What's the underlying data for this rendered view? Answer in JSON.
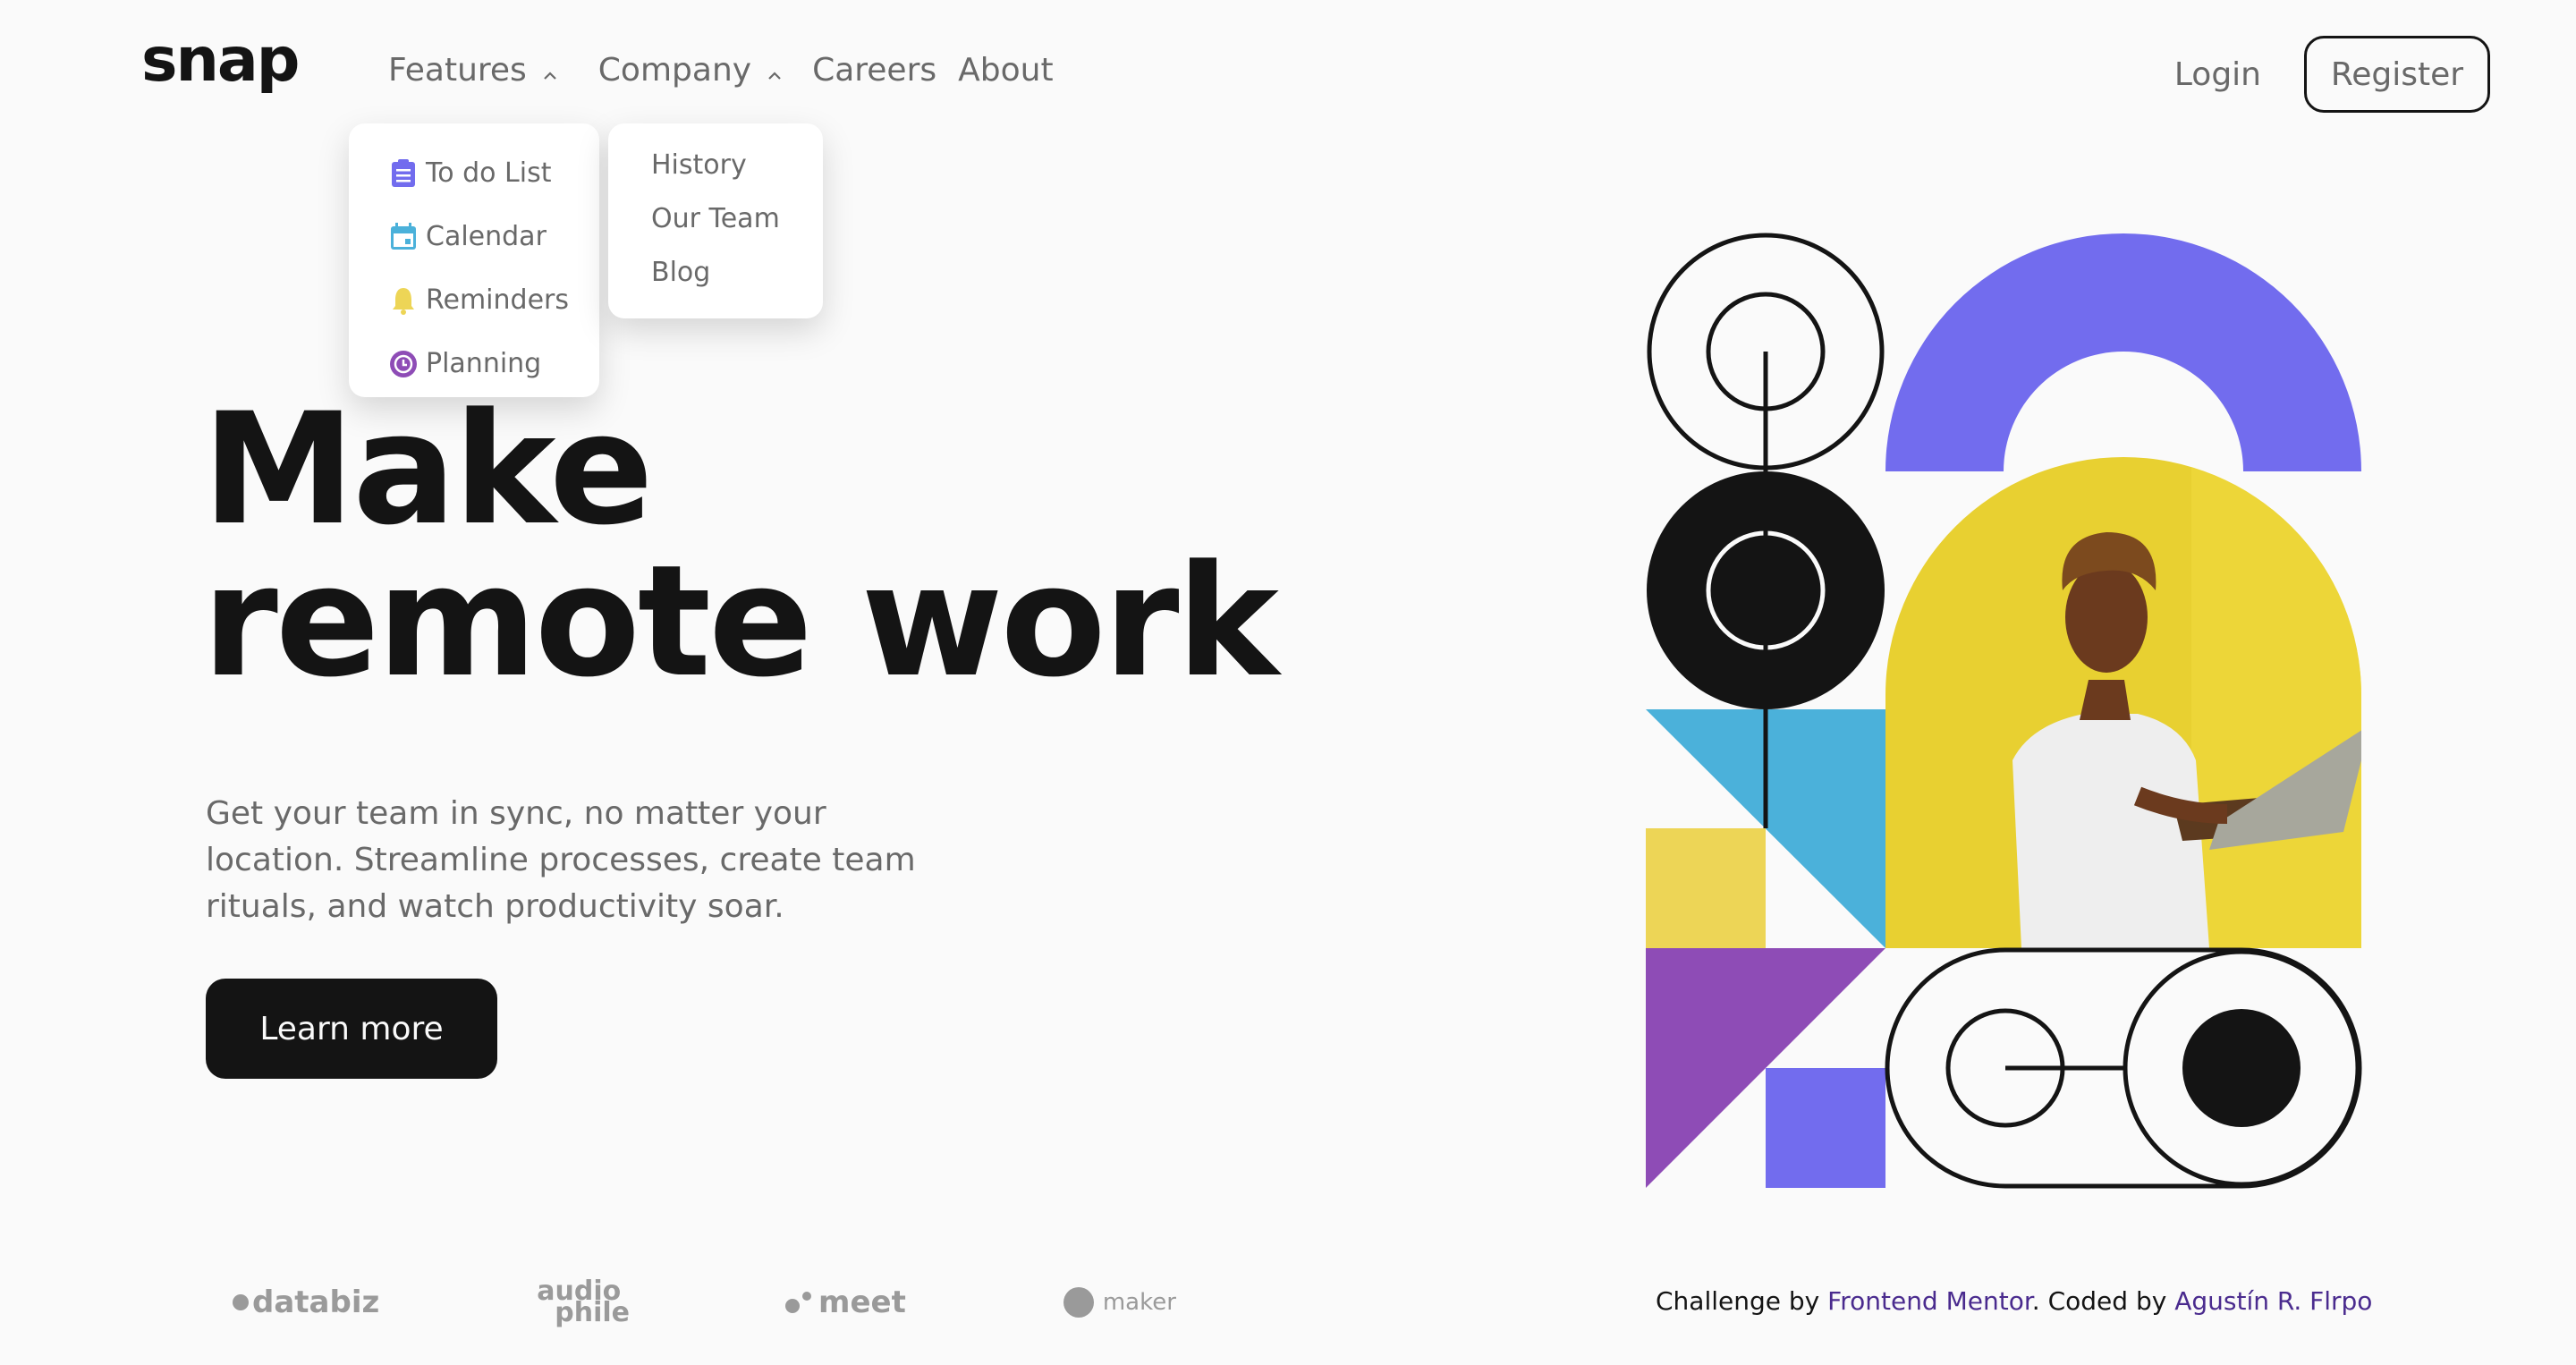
{
  "brand": {
    "logo": "snap"
  },
  "nav": {
    "features": "Features",
    "company": "Company",
    "careers": "Careers",
    "about": "About"
  },
  "features_menu": {
    "items": [
      {
        "label": "To do List",
        "icon": "todo-list-icon",
        "color": "#726CEE"
      },
      {
        "label": "Calendar",
        "icon": "calendar-icon",
        "color": "#4BB1DA"
      },
      {
        "label": "Reminders",
        "icon": "bell-icon",
        "color": "#EDD556"
      },
      {
        "label": "Planning",
        "icon": "planning-clock-icon",
        "color": "#8E4CB6"
      }
    ]
  },
  "company_menu": {
    "items": [
      "History",
      "Our Team",
      "Blog"
    ]
  },
  "auth": {
    "login": "Login",
    "register": "Register"
  },
  "hero": {
    "title_line1": "Make",
    "title_line2": "remote work",
    "description": "Get your team in sync, no matter your location. Streamline processes, create team rituals, and watch productivity soar.",
    "cta": "Learn more"
  },
  "clients": {
    "databiz": "databiz",
    "audiophile_top": "audio",
    "audiophile_bottom": "phile",
    "meet": "meet",
    "maker": "maker"
  },
  "attribution": {
    "prefix": "Challenge by",
    "challenge_link": "Frontend Mentor",
    "middle": ". Coded by",
    "author_link": "Agustín R. Flrpo"
  },
  "colors": {
    "purple": "#726CEE",
    "blue": "#4BB1DA",
    "yellow": "#EDD556",
    "violet": "#8E4CB6",
    "dark": "#141414",
    "text_gray": "#696969",
    "link": "#4A2B8E"
  }
}
